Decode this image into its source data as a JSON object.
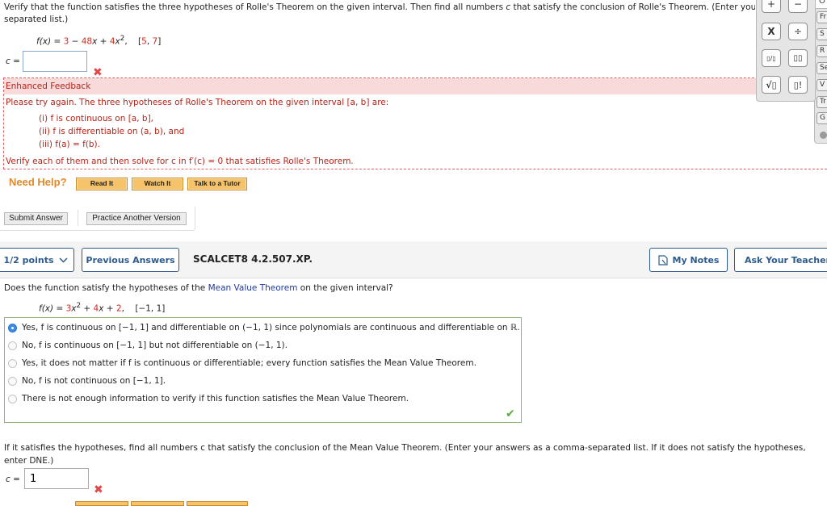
{
  "question1": {
    "intro_line1_a": "Verify that the function satisfies the three hypotheses of Rolle's Theorem on the given interval. Then find all numbers ",
    "intro_var": "c",
    "intro_line1_b": " that satisfy the conclusion of Rolle's Theorem. (Enter your a",
    "intro_line2": "separated list.)",
    "function": {
      "lhs": "f(x) = ",
      "c0": "3",
      "op1": " − ",
      "c1": "48",
      "x1": "x",
      "op2": " + ",
      "c2": "4",
      "x2": "x",
      "exp": "2",
      "comma": ",",
      "interval_open": "[",
      "a": "5",
      "sep": ", ",
      "b": "7",
      "interval_close": "]"
    },
    "answer_label": "c =",
    "answer_value": "",
    "status_icon": "✖"
  },
  "feedback": {
    "header": "Enhanced Feedback",
    "line1": "Please try again. The three hypotheses of Rolle's Theorem on the given interval  [a, b]  are:",
    "items": [
      "(i)  f  is continuous on  [a, b],",
      "(ii)  f  is differentiable on  (a, b),  and",
      "(iii)  f(a) = f(b)."
    ],
    "line_final": "Verify each of them and then solve for c in  f′(c) = 0  that satisfies Rolle's Theorem."
  },
  "help": {
    "label": "Need Help?",
    "buttons": [
      "Read It",
      "Watch It",
      "Talk to a Tutor"
    ]
  },
  "actions": {
    "submit": "Submit Answer",
    "practice": "Practice Another Version"
  },
  "question2_header": {
    "points": "1/2 points",
    "points_icon": "chevron-down",
    "previous": "Previous Answers",
    "code": "SCALCET8 4.2.507.XP.",
    "my_notes": "My Notes",
    "ask_teacher": "Ask Your Teacher"
  },
  "question2": {
    "text_a": "Does the function satisfy the hypotheses of the ",
    "text_link": "Mean Value Theorem",
    "text_b": " on the given interval?",
    "function": {
      "lhs": "f(x) = ",
      "c2": "3",
      "x2": "x",
      "exp": "2",
      "op1": " + ",
      "c1": "4",
      "x1": "x",
      "op2": " + ",
      "c0": "2",
      "interval": ",    [−1, 1]"
    },
    "options": [
      {
        "text": "Yes, f is continuous on [−1, 1] and differentiable on (−1, 1) since polynomials are continuous and differentiable on ℝ.",
        "selected": true
      },
      {
        "text": "No, f is continuous on [−1, 1] but not differentiable on (−1, 1).",
        "selected": false
      },
      {
        "text": "Yes, it does not matter if f is continuous or differentiable; every function satisfies the Mean Value Theorem.",
        "selected": false
      },
      {
        "text": "No, f is not continuous on [−1, 1].",
        "selected": false
      },
      {
        "text": "There is not enough information to verify if this function satisfies the Mean Value Theorem.",
        "selected": false
      }
    ],
    "status_icon": "✔"
  },
  "question3": {
    "text": "If it satisfies the hypotheses, find all numbers c that satisfy the conclusion of the Mean Value Theorem. (Enter your answers as a comma-separated list. If it does not satisfy the hypotheses, enter DNE.)",
    "answer_label": "c =",
    "answer_value": "1",
    "status_icon": "✖"
  },
  "calculator": {
    "buttons": [
      "+",
      "−",
      "X",
      "÷",
      "▯/▯",
      "▯▯",
      "√▯",
      "▯!"
    ],
    "side_tabs": [
      "Fr",
      "S",
      "R",
      "Se",
      "V",
      "Tr",
      "G"
    ],
    "side_top": "O"
  }
}
